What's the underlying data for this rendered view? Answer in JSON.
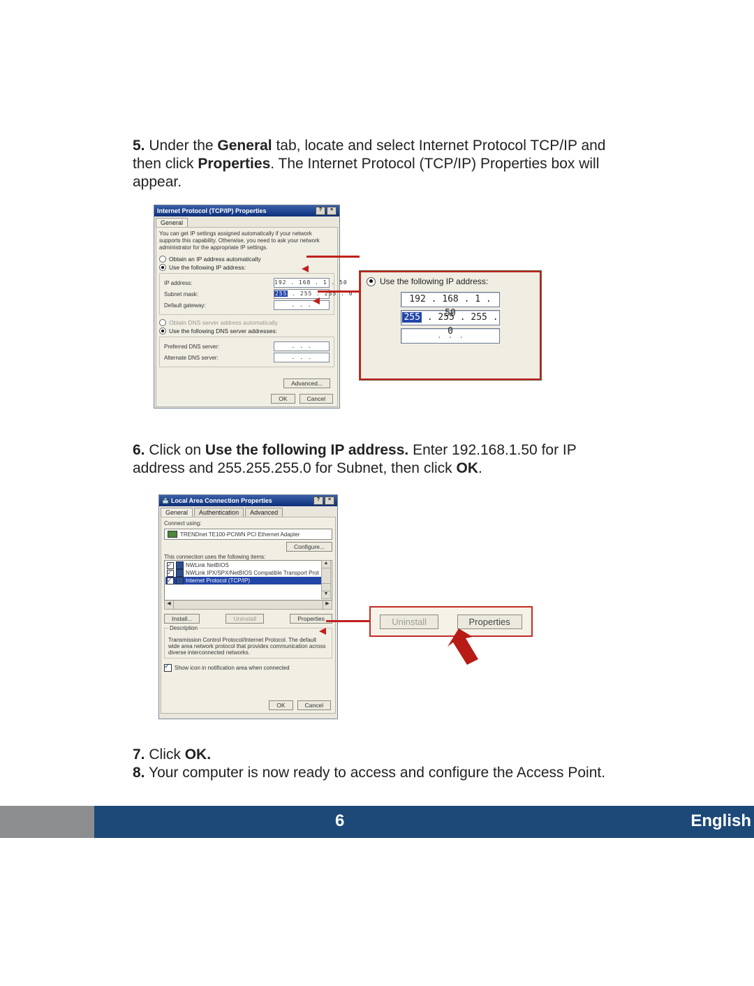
{
  "steps": {
    "s5": {
      "num": "5.",
      "text_pre": "Under the ",
      "bold1": "General",
      "text_mid1": " tab, locate and select Internet Protocol TCP/IP and then click ",
      "bold2": "Properties",
      "text_post": ". The Internet Protocol (TCP/IP) Properties box will appear."
    },
    "s6": {
      "num": "6.",
      "text_pre": "Click on ",
      "bold1": "Use the following IP address.",
      "text_mid1": " Enter 192.168.1.50 for IP address and 255.255.255.0 for Subnet, then click ",
      "bold2": "OK",
      "text_post": "."
    },
    "s7": {
      "num": "7.",
      "text_pre": "Click ",
      "bold1": "OK."
    },
    "s8": {
      "num": "8.",
      "text": "Your computer is now ready to access and configure the Access Point."
    }
  },
  "dlg1": {
    "title": "Internet Protocol (TCP/IP) Properties",
    "tb_help": "?",
    "tb_close": "×",
    "tab_general": "General",
    "explain": "You can get IP settings assigned automatically if your network supports this capability. Otherwise, you need to ask your network administrator for the appropriate IP settings.",
    "r_auto_ip": "Obtain an IP address automatically",
    "r_use_ip": "Use the following IP address:",
    "lbl_ip": "IP address:",
    "lbl_subnet": "Subnet mask:",
    "lbl_gw": "Default gateway:",
    "ip_val": "192 . 168 .   1  .  50",
    "subnet_seg_sel": "255",
    "subnet_rest": " . 255 . 255 .   0",
    "gw_val": "   .    .    .   ",
    "r_auto_dns": "Obtain DNS server address automatically",
    "r_use_dns": "Use the following DNS server addresses:",
    "lbl_pdns": "Preferred DNS server:",
    "lbl_adns": "Alternate DNS server:",
    "dns_empty": "   .    .    .   ",
    "btn_adv": "Advanced...",
    "btn_ok": "OK",
    "btn_cancel": "Cancel"
  },
  "zoom1": {
    "radio": "Use the following IP address:",
    "ip": "192 . 168 .   1   .  50",
    "sub_sel": "255",
    "sub_rest": " . 255 . 255 .   0",
    "empty": "    .      .      .    "
  },
  "dlg2": {
    "title": "Local Area Connection Properties",
    "tb_help": "?",
    "tb_close": "×",
    "tab_general": "General",
    "tab_auth": "Authentication",
    "tab_adv": "Advanced",
    "lbl_connect": "Connect using:",
    "adapter": "TRENDnet TE100-PCIWN PCI Ethernet Adapter",
    "btn_configure": "Configure...",
    "lbl_items": "This connection uses the following items:",
    "item1": "NWLink NetBIOS",
    "item2": "NWLink IPX/SPX/NetBIOS Compatible Transport Prot",
    "item3": "Internet Protocol (TCP/IP)",
    "btn_install": "Install...",
    "btn_uninstall": "Uninstall",
    "btn_props": "Properties",
    "grp_desc": "Description",
    "desc_text": "Transmission Control Protocol/Internet Protocol. The default wide area network protocol that provides communication across diverse interconnected networks.",
    "chk_show": "Show icon in notification area when connected",
    "btn_ok": "OK",
    "btn_cancel": "Cancel"
  },
  "zoom2": {
    "btn_uninstall": "Uninstall",
    "btn_props": "Properties"
  },
  "footer": {
    "page": "6",
    "lang": "English"
  }
}
